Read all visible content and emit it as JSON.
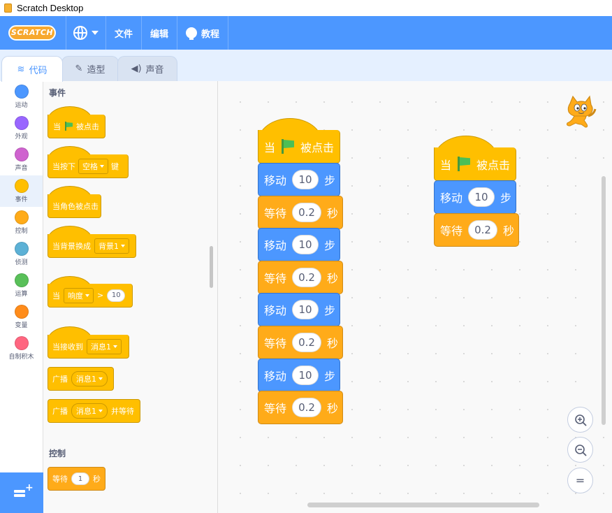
{
  "window": {
    "title": "Scratch Desktop"
  },
  "menubar": {
    "logo": "SCRATCH",
    "file": "文件",
    "edit": "编辑",
    "tutorials": "教程"
  },
  "tabs": [
    {
      "label": "代码"
    },
    {
      "label": "造型"
    },
    {
      "label": "声音"
    }
  ],
  "categories": [
    {
      "label": "运动",
      "color": "#4c97ff"
    },
    {
      "label": "外观",
      "color": "#9966ff"
    },
    {
      "label": "声音",
      "color": "#cf63cf"
    },
    {
      "label": "事件",
      "color": "#ffbf00"
    },
    {
      "label": "控制",
      "color": "#ffab19"
    },
    {
      "label": "侦测",
      "color": "#5cb1d6"
    },
    {
      "label": "运算",
      "color": "#59c059"
    },
    {
      "label": "变量",
      "color": "#ff8c1a"
    },
    {
      "label": "自制积木",
      "color": "#ff6680"
    }
  ],
  "palette": {
    "events_label": "事件",
    "control_label": "控制",
    "when_flag": {
      "prefix": "当",
      "suffix": "被点击"
    },
    "when_key": {
      "prefix": "当按下",
      "key": "空格",
      "suffix": "键"
    },
    "when_sprite_clicked": "当角色被点击",
    "when_backdrop": {
      "prefix": "当背景换成",
      "value": "背景1"
    },
    "when_greater": {
      "prefix": "当",
      "sensor": "响度",
      "op": ">",
      "value": "10"
    },
    "when_receive": {
      "prefix": "当接收到",
      "value": "消息1"
    },
    "broadcast": {
      "prefix": "广播",
      "value": "消息1"
    },
    "broadcast_wait": {
      "prefix": "广播",
      "value": "消息1",
      "suffix": "并等待"
    },
    "wait": {
      "prefix": "等待",
      "value": "1",
      "suffix": "秒"
    }
  },
  "scripts": {
    "hat": {
      "prefix": "当",
      "suffix": "被点击"
    },
    "move": {
      "prefix": "移动",
      "value": "10",
      "suffix": "步"
    },
    "wait": {
      "prefix": "等待",
      "value": "0.2",
      "suffix": "秒"
    }
  },
  "zoom": {
    "in": "+",
    "out": "−",
    "reset": "="
  }
}
